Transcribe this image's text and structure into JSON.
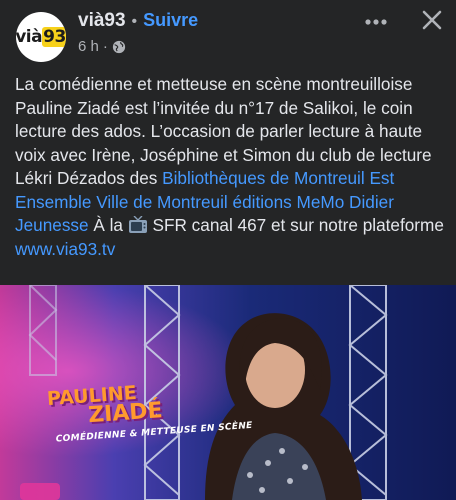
{
  "header": {
    "avatar_text_a": "vià",
    "avatar_text_b": "93",
    "page_name": "vià93",
    "separator": "•",
    "follow_label": "Suivre",
    "time": "6 h",
    "time_separator": "·",
    "privacy_icon": "globe-icon",
    "more_icon": "more-horizontal-icon",
    "close_icon": "close-icon"
  },
  "post": {
    "text_1": "La comédienne et metteuse en scène montreuilloise Pauline Ziadé  est l’invitée du n°17 de Salikoi, le coin lecture des ados. L’occasion de parler lecture à haute voix avec Irène, Joséphine et Simon du club de lecture Lékri Dézados des ",
    "mentions": "Bibliothèques de Montreuil Est Ensemble Ville de Montreuil éditions MeMo Didier Jeunesse",
    "text_2": " À la ",
    "tv_icon": "television-icon",
    "text_3": " SFR canal 467 et sur notre plateforme",
    "link": "www.via93.tv"
  },
  "media": {
    "overlay_line1": "PAULINE",
    "overlay_line2": "ZIADÉ",
    "overlay_line3": "COMÉDIENNE & METTEUSE EN SCÈNE"
  },
  "colors": {
    "background": "#242526",
    "text": "#e4e6eb",
    "secondary_text": "#b0b3b8",
    "link": "#4599ff",
    "avatar_accent": "#f7d11a"
  }
}
